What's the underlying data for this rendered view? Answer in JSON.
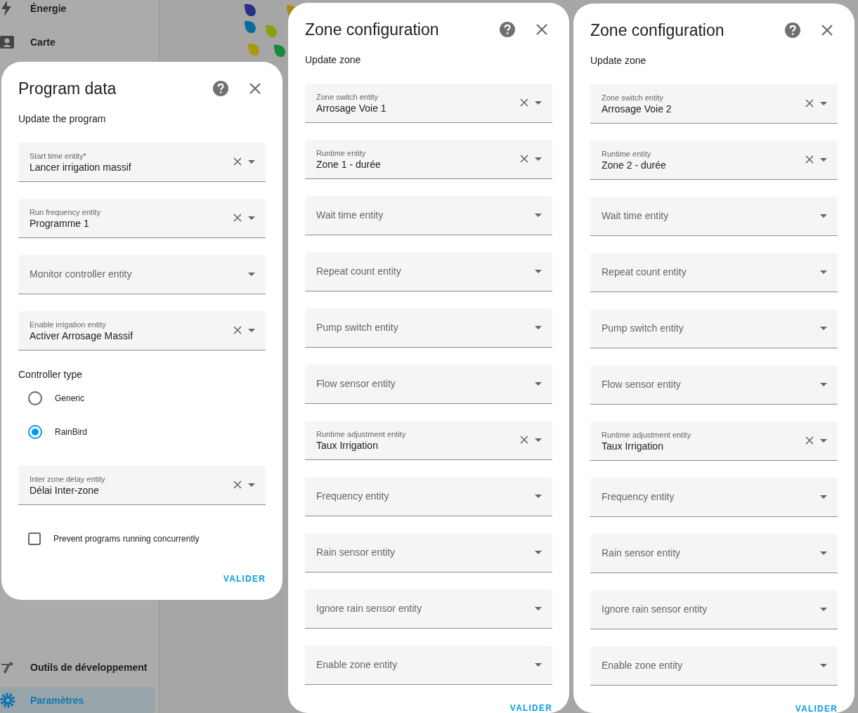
{
  "sidebar": {
    "items": [
      {
        "label": "Énergie",
        "selected": false
      },
      {
        "label": "Carte",
        "selected": false
      },
      {
        "label": "Outils de développement",
        "selected": false
      },
      {
        "label": "Paramètres",
        "selected": true
      }
    ]
  },
  "dialogs": [
    {
      "title": "Program data",
      "subtitle": "Update the program",
      "items": [
        {
          "kind": "field",
          "label": "Start time entity*",
          "value": "Lancer irrigation massif"
        },
        {
          "kind": "field",
          "label": "Run frequency entity",
          "value": "Programme 1"
        },
        {
          "kind": "field",
          "label": "Monitor controller entity"
        },
        {
          "kind": "field",
          "label": "Enable irrigation entity",
          "value": "Activer Arrosage Massif"
        },
        {
          "kind": "radio_group",
          "label": "Controller type",
          "options": [
            {
              "label": "Generic",
              "selected": false
            },
            {
              "label": "RainBird",
              "selected": true
            }
          ]
        },
        {
          "kind": "field",
          "label": "Inter zone delay entity",
          "value": "Délai Inter-zone"
        },
        {
          "kind": "checkbox",
          "label": "Prevent programs running concurrently",
          "checked": false
        }
      ],
      "submit": "VALIDER"
    },
    {
      "title": "Zone configuration",
      "subtitle": "Update zone",
      "items": [
        {
          "kind": "field",
          "label": "Zone switch entity",
          "value": "Arrosage Voie 1"
        },
        {
          "kind": "field",
          "label": "Runtime entity",
          "value": "Zone 1 - durée"
        },
        {
          "kind": "field",
          "label": "Wait time entity"
        },
        {
          "kind": "field",
          "label": "Repeat count entity"
        },
        {
          "kind": "field",
          "label": "Pump switch entity"
        },
        {
          "kind": "field",
          "label": "Flow sensor entity"
        },
        {
          "kind": "field",
          "label": "Runtime adjustment entity",
          "value": "Taux Irrigation"
        },
        {
          "kind": "field",
          "label": "Frequency entity"
        },
        {
          "kind": "field",
          "label": "Rain sensor entity"
        },
        {
          "kind": "field",
          "label": "Ignore rain sensor entity"
        },
        {
          "kind": "field",
          "label": "Enable zone entity"
        }
      ],
      "submit": "VALIDER"
    },
    {
      "title": "Zone configuration",
      "subtitle": "Update zone",
      "items": [
        {
          "kind": "field",
          "label": "Zone switch entity",
          "value": "Arrosage Voie 2"
        },
        {
          "kind": "field",
          "label": "Runtime entity",
          "value": "Zone 2 - durée"
        },
        {
          "kind": "field",
          "label": "Wait time entity"
        },
        {
          "kind": "field",
          "label": "Repeat count entity"
        },
        {
          "kind": "field",
          "label": "Pump switch entity"
        },
        {
          "kind": "field",
          "label": "Flow sensor entity"
        },
        {
          "kind": "field",
          "label": "Runtime adjustment entity",
          "value": "Taux Irrigation"
        },
        {
          "kind": "field",
          "label": "Frequency entity"
        },
        {
          "kind": "field",
          "label": "Rain sensor entity"
        },
        {
          "kind": "field",
          "label": "Ignore rain sensor entity"
        },
        {
          "kind": "field",
          "label": "Enable zone entity"
        }
      ],
      "submit": "VALIDER"
    }
  ]
}
